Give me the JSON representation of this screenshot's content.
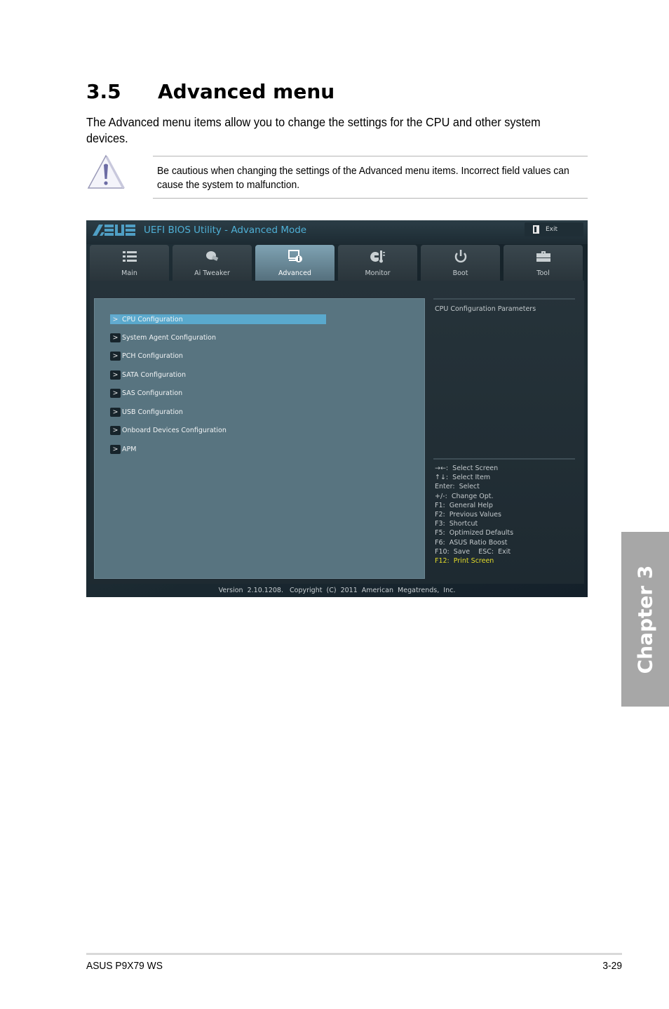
{
  "section": {
    "number": "3.5",
    "title": "Advanced menu",
    "intro": "The Advanced menu items allow you to change the settings for the CPU and other system devices."
  },
  "note": {
    "icon": "warning-icon",
    "text": "Be cautious when changing the settings of the Advanced menu items. Incorrect field values can cause the system to malfunction."
  },
  "bios": {
    "logo": "ASUS",
    "title": "UEFI BIOS Utility - Advanced Mode",
    "exit_label": "Exit",
    "tabs": [
      {
        "label": "Main",
        "icon": "list-icon",
        "active": false
      },
      {
        "label": "Ai  Tweaker",
        "icon": "tweaker-icon",
        "active": false
      },
      {
        "label": "Advanced",
        "icon": "advanced-icon",
        "active": true
      },
      {
        "label": "Monitor",
        "icon": "monitor-icon",
        "active": false
      },
      {
        "label": "Boot",
        "icon": "power-icon",
        "active": false
      },
      {
        "label": "Tool",
        "icon": "toolbox-icon",
        "active": false
      }
    ],
    "menu_items": [
      {
        "label": "CPU Configuration",
        "selected": true
      },
      {
        "label": "System Agent Configuration",
        "selected": false
      },
      {
        "label": "PCH Configuration",
        "selected": false
      },
      {
        "label": "SATA Configuration",
        "selected": false
      },
      {
        "label": "SAS Configuration",
        "selected": false
      },
      {
        "label": "USB Configuration",
        "selected": false
      },
      {
        "label": "Onboard Devices Configuration",
        "selected": false
      },
      {
        "label": "APM",
        "selected": false
      }
    ],
    "menu_arrow": ">",
    "help_title": "CPU Configuration Parameters",
    "keys": [
      "→←:  Select Screen",
      "↑↓:  Select Item",
      "Enter:  Select",
      "+/-:  Change Opt.",
      "F1:  General Help",
      "F2:  Previous Values",
      "F3:  Shortcut",
      "F5:  Optimized Defaults",
      "F6:  ASUS Ratio Boost",
      "F10:  Save    ESC:  Exit",
      "F12:  Print Screen"
    ],
    "highlight_key_color": "#e4dc2a",
    "selected_color": "#5aa9cd",
    "title_color": "#4fb0d6",
    "footer": "Version  2.10.1208.   Copyright  (C)  2011  American  Megatrends,  Inc."
  },
  "chapter_tab": "Chapter 3",
  "footer": {
    "product": "ASUS P9X79 WS",
    "page": "3-29"
  }
}
